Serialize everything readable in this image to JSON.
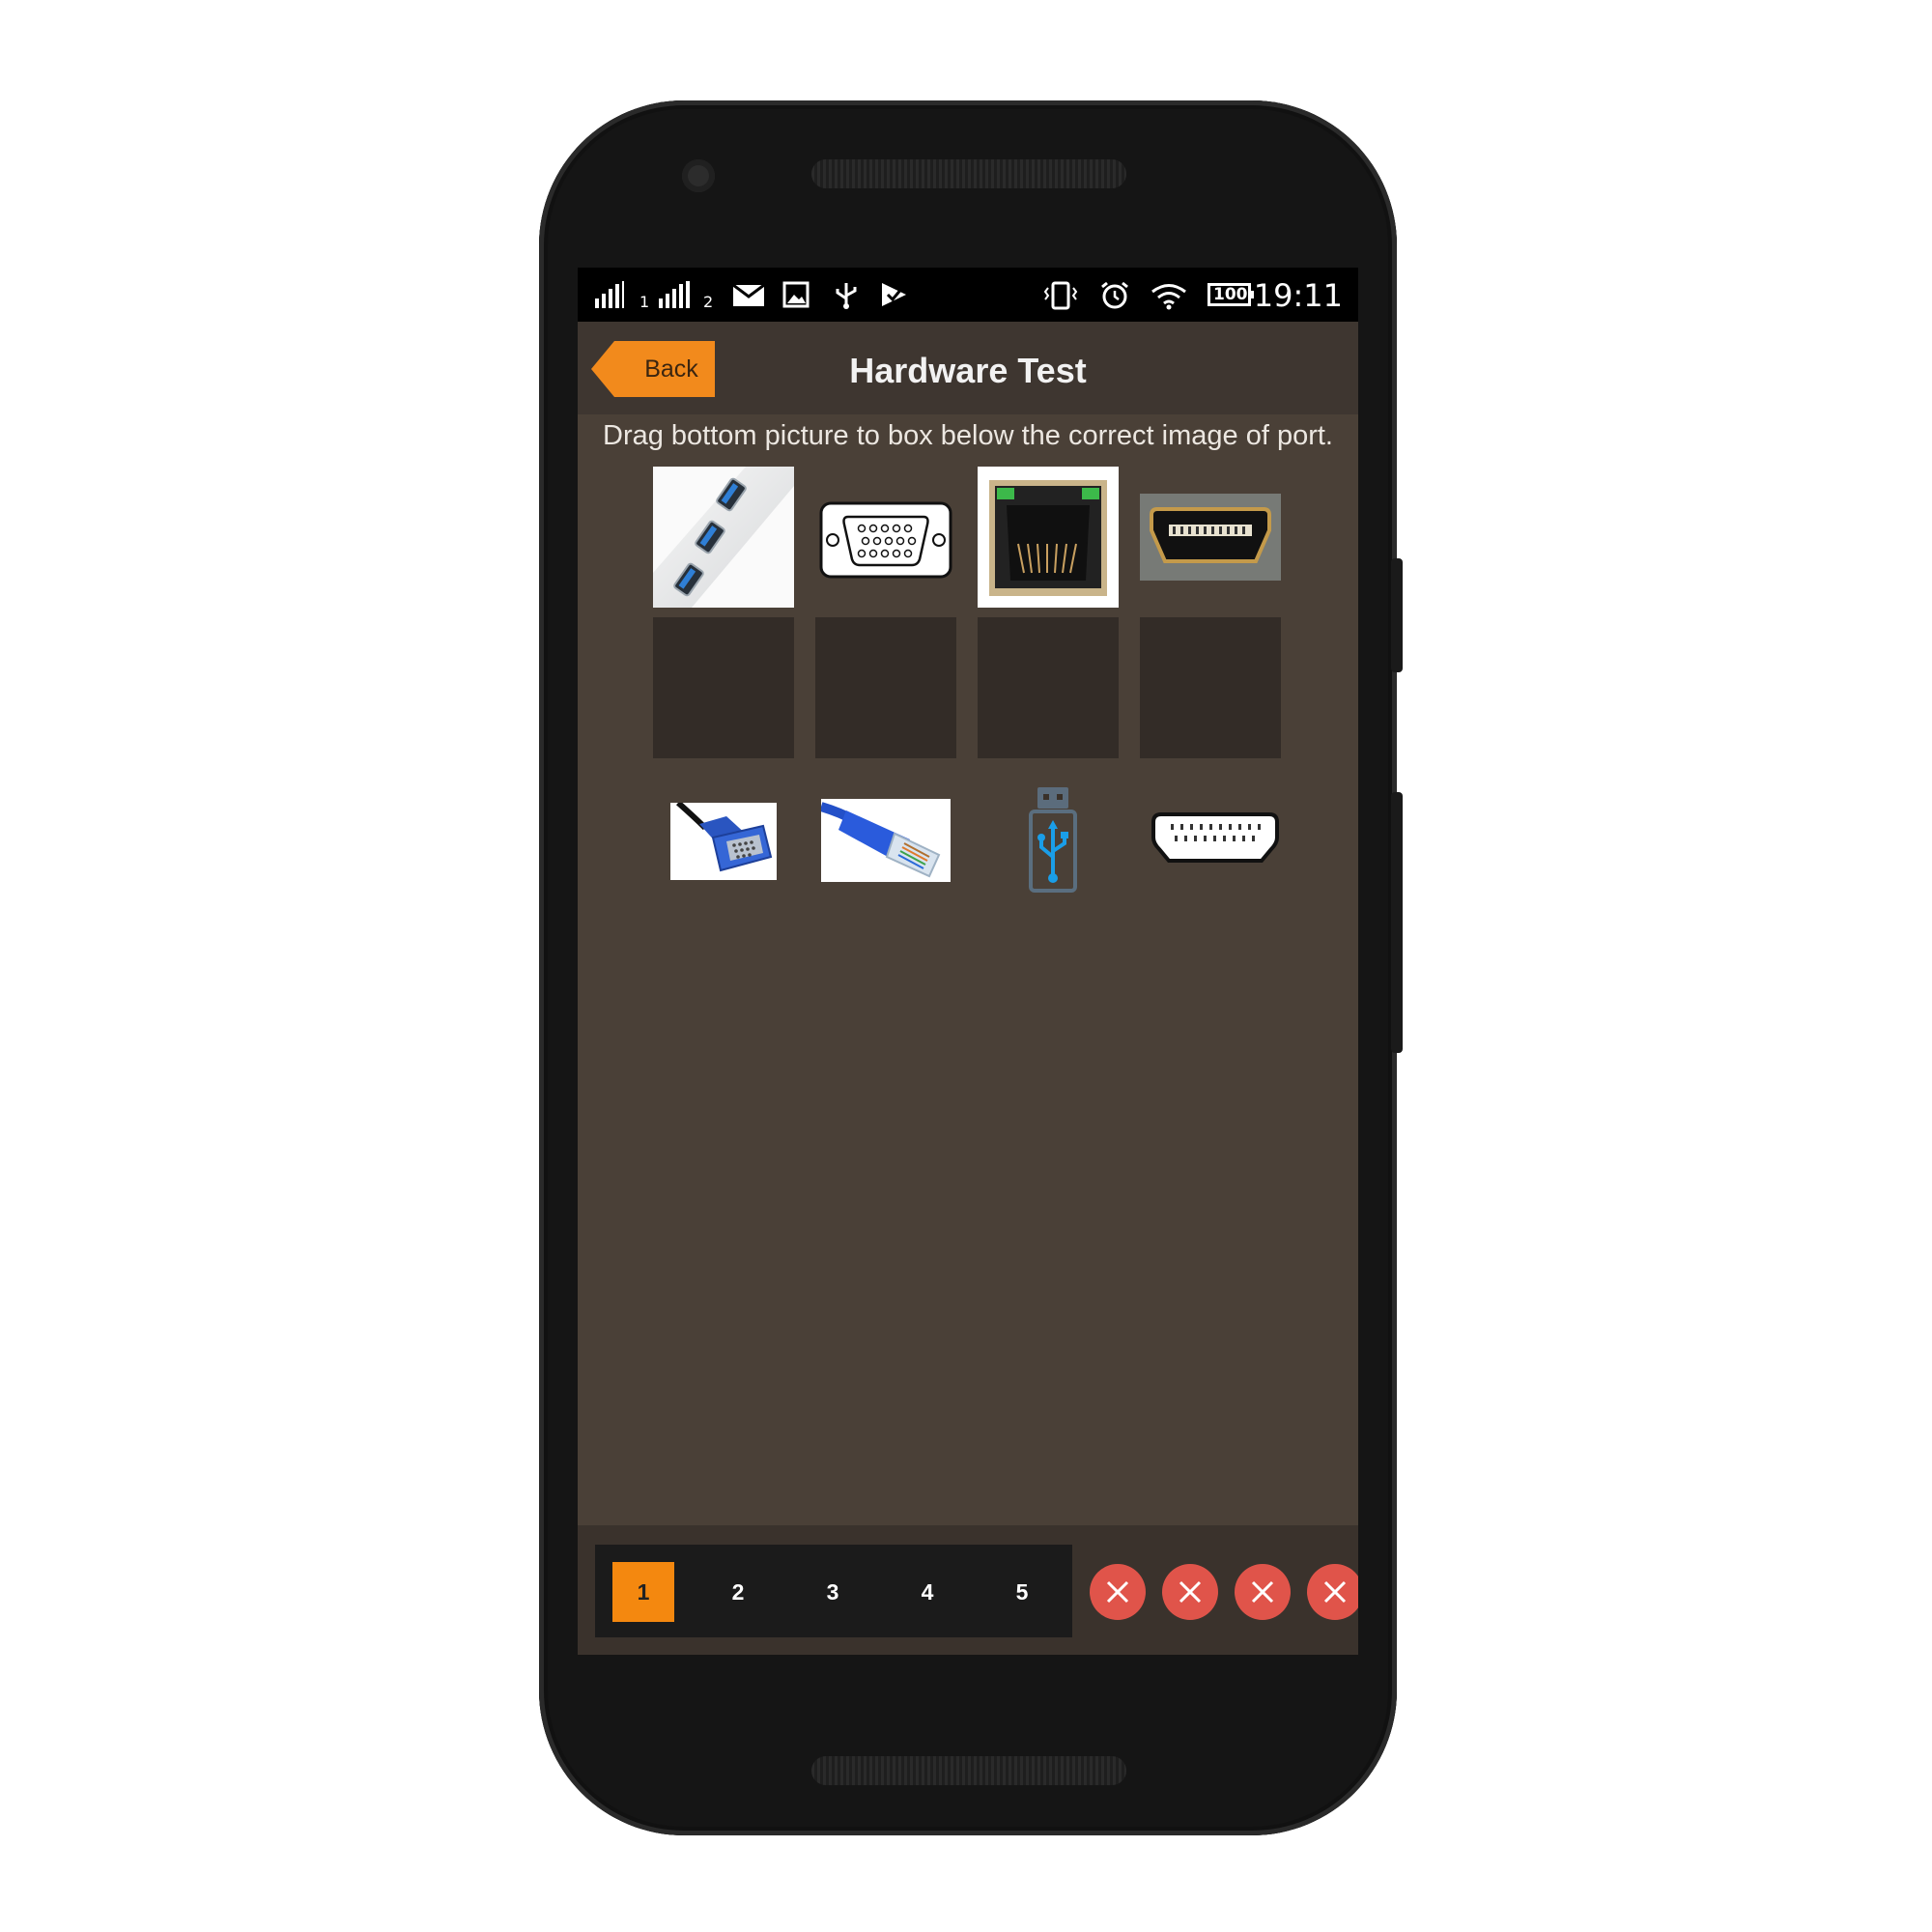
{
  "status_bar": {
    "time": "19:11",
    "battery": "100",
    "sim1_label": "1",
    "sim2_label": "2",
    "icons": [
      "signal-icon",
      "signal-icon",
      "mail-icon",
      "image-icon",
      "usb-icon",
      "play-store-icon",
      "vibrate-icon",
      "alarm-icon",
      "wifi-icon",
      "battery-icon"
    ]
  },
  "header": {
    "back_label": "Back",
    "title": "Hardware Test"
  },
  "instruction": "Drag bottom picture to box below the correct image of port.",
  "ports": [
    {
      "name": "usb-port-image"
    },
    {
      "name": "vga-port-image"
    },
    {
      "name": "ethernet-port-image"
    },
    {
      "name": "hdmi-port-image"
    }
  ],
  "pieces": [
    {
      "name": "vga-cable-image"
    },
    {
      "name": "ethernet-cable-image"
    },
    {
      "name": "usb-drive-image"
    },
    {
      "name": "hdmi-connector-image"
    }
  ],
  "pager": {
    "pages": [
      "1",
      "2",
      "3",
      "4",
      "5"
    ],
    "active_index": 0
  },
  "results": [
    "wrong",
    "wrong",
    "wrong",
    "wrong"
  ],
  "colors": {
    "accent": "#f4880f",
    "background": "#4a4037",
    "wrong": "#e0544a"
  }
}
